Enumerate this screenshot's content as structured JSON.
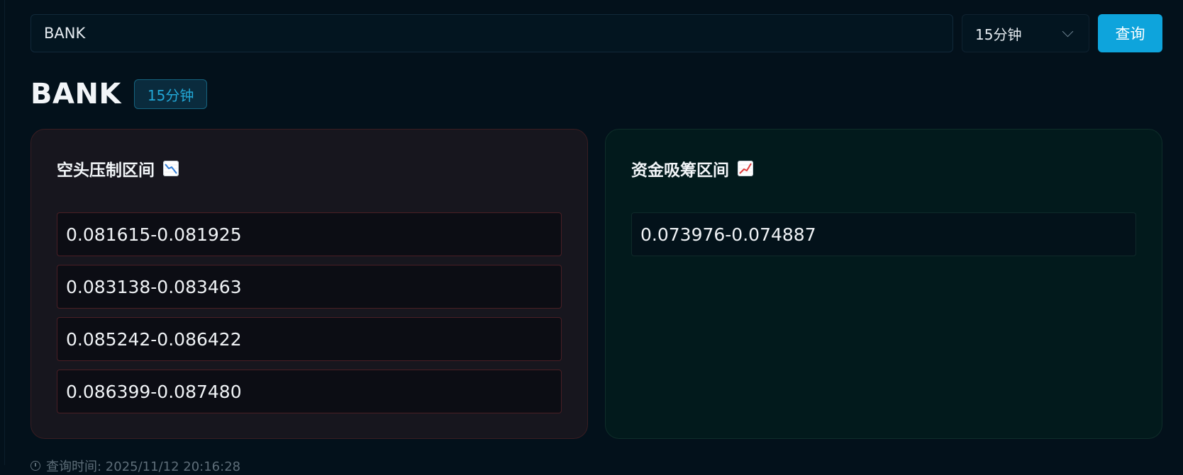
{
  "search": {
    "value": "BANK",
    "interval_selected": "15分钟",
    "query_label": "查询"
  },
  "header": {
    "symbol": "BANK",
    "interval_badge": "15分钟"
  },
  "panels": {
    "short_pressure": {
      "title": "空头压制区间",
      "icon": "chart-decreasing-icon",
      "ranges": [
        "0.081615-0.081925",
        "0.083138-0.083463",
        "0.085242-0.086422",
        "0.086399-0.087480"
      ]
    },
    "accumulation": {
      "title": "资金吸筹区间",
      "icon": "chart-increasing-icon",
      "ranges": [
        "0.073976-0.074887"
      ]
    }
  },
  "footer": {
    "query_time": "查询时间: 2025/11/12 20:16:28"
  },
  "colors": {
    "accent": "#0ea4dc",
    "short_border": "#4a1f25",
    "long_border": "#0f2a2a",
    "trend_down": "#2e7bd6",
    "trend_up": "#e03b3b"
  }
}
